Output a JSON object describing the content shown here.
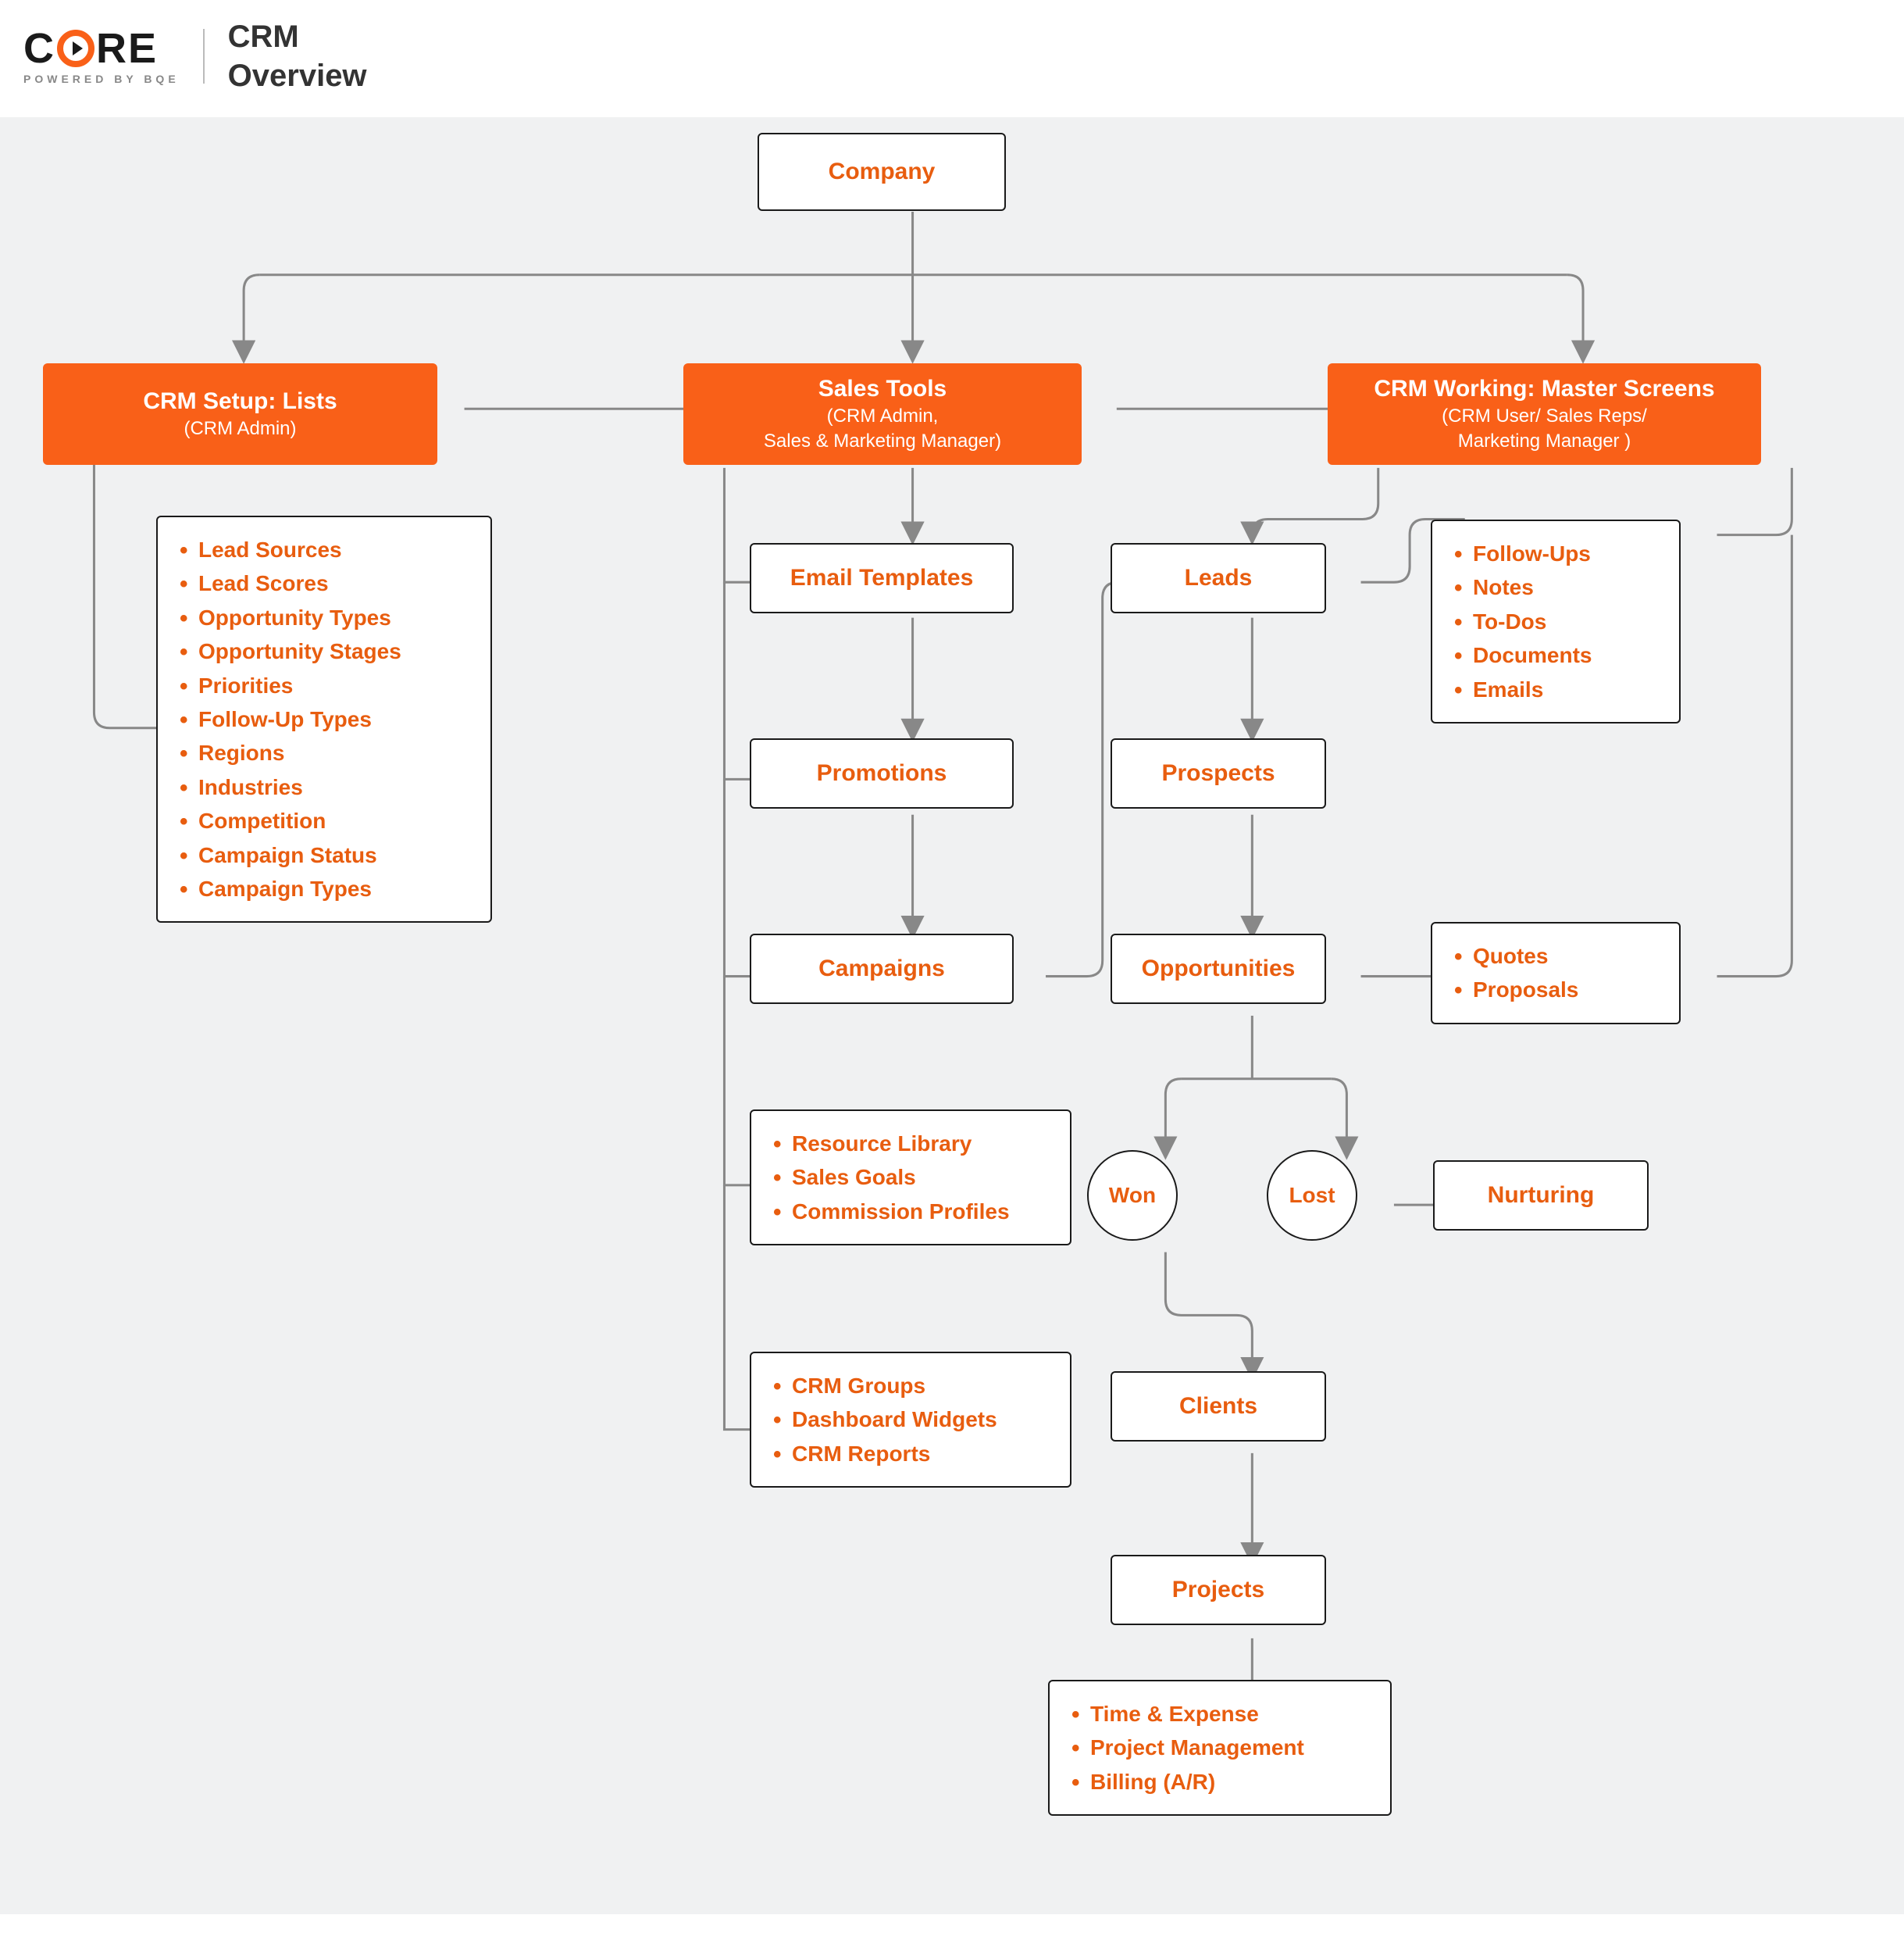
{
  "header": {
    "logo_left": "C",
    "logo_right": "RE",
    "logo_sub": "POWERED BY BQE",
    "title_line1": "CRM",
    "title_line2": "Overview"
  },
  "nodes": {
    "company": "Company",
    "setup": {
      "title": "CRM Setup: Lists",
      "sub": "(CRM Admin)"
    },
    "sales": {
      "title": "Sales Tools",
      "sub1": "(CRM Admin,",
      "sub2": "Sales & Marketing Manager)"
    },
    "working": {
      "title": "CRM Working: Master Screens",
      "sub1": "(CRM User/ Sales Reps/",
      "sub2": "Marketing Manager )"
    },
    "email": "Email Templates",
    "promotions": "Promotions",
    "campaigns": "Campaigns",
    "leads": "Leads",
    "prospects": "Prospects",
    "opportunities": "Opportunities",
    "won": "Won",
    "lost": "Lost",
    "nurturing": "Nurturing",
    "clients": "Clients",
    "projects": "Projects"
  },
  "lists": {
    "setup": [
      "Lead Sources",
      "Lead Scores",
      "Opportunity Types",
      "Opportunity Stages",
      "Priorities",
      "Follow-Up Types",
      "Regions",
      "Industries",
      "Competition",
      "Campaign Status",
      "Campaign Types"
    ],
    "sales1": [
      "Resource Library",
      "Sales Goals",
      "Commission Profiles"
    ],
    "sales2": [
      "CRM Groups",
      "Dashboard Widgets",
      "CRM Reports"
    ],
    "working1": [
      "Follow-Ups",
      "Notes",
      "To-Dos",
      "Documents",
      "Emails"
    ],
    "working2": [
      "Quotes",
      "Proposals"
    ],
    "projects": [
      "Time & Expense",
      "Project Management",
      "Billing (A/R)"
    ]
  }
}
